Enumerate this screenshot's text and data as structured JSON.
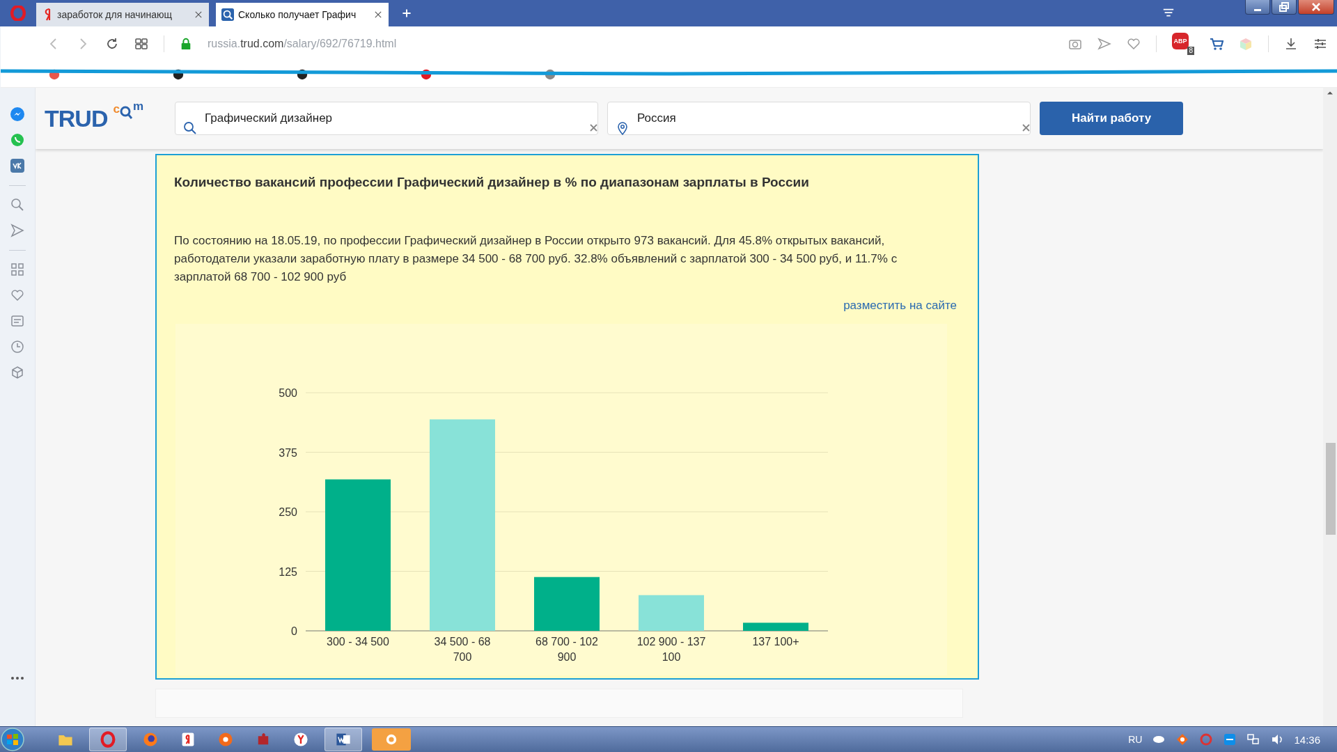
{
  "browser": {
    "tabs": [
      {
        "title": "заработок для начинающ",
        "kind": "yandex",
        "selected": false
      },
      {
        "title": "Сколько получает Графич",
        "kind": "search",
        "selected": true
      }
    ],
    "url": {
      "host": "russia.",
      "domain": "trud.com",
      "path": "/salary/692/76719.html"
    },
    "adblock": {
      "label": "ABP",
      "count": "8"
    }
  },
  "page": {
    "logo": {
      "main": "TRUD",
      "left": "c",
      "right": "m"
    },
    "search": {
      "value": "Графический дизайнер"
    },
    "location": {
      "value": "Россия"
    },
    "search_button": "Найти работу",
    "card": {
      "title": "Количество вакансий профессии Графический дизайнер в % по диапазонам зарплаты в России",
      "text": "По состоянию на 18.05.19, по профессии Графический дизайнер в России открыто 973 вакансий. Для 45.8% открытых вакансий, работодатели указали заработную плату в размере 34 500 - 68 700 руб. 32.8% объявлений с зарплатой 300 - 34 500 руб, и 11.7% с зарплатой 68 700 - 102 900 руб",
      "link": "разместить на сайте",
      "chart_data": {
        "type": "bar",
        "categories": [
          "300 - 34 500",
          "34 500 - 68 700",
          "68 700 - 102 900",
          "102 900 - 137 100",
          "137 100+"
        ],
        "series": [
          {
            "color": "#00b08a",
            "values": [
              318,
              null,
              113,
              null,
              17
            ]
          },
          {
            "color": "#88e2d8",
            "values": [
              null,
              444,
              null,
              75,
              null
            ]
          }
        ],
        "grid": true,
        "ylim": [
          0,
          500
        ],
        "yticks": [
          0,
          125,
          250,
          375,
          500
        ]
      }
    }
  },
  "taskbar": {
    "language": "RU",
    "time": "14:36"
  }
}
